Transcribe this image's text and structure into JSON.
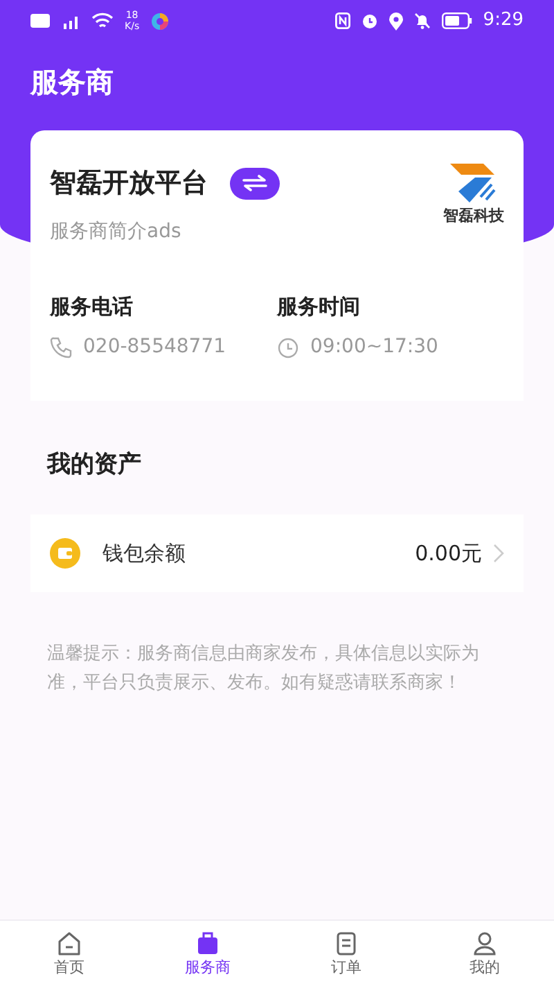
{
  "status_bar": {
    "speed": "18\nK/s",
    "time": "9:29"
  },
  "header": {
    "title": "服务商"
  },
  "provider": {
    "name": "智磊开放平台",
    "intro": "服务商简介ads",
    "logo_caption": "智磊科技"
  },
  "contact": [
    {
      "kind": "phone",
      "label": "服务电话",
      "value": "020-85548771"
    },
    {
      "kind": "time",
      "label": "服务时间",
      "value": "09:00~17:30"
    }
  ],
  "assets": {
    "title": "我的资产",
    "rows": [
      {
        "label": "钱包余额",
        "value": "0.00元"
      }
    ]
  },
  "notice": "温馨提示：服务商信息由商家发布，具体信息以实际为准，平台只负责展示、发布。如有疑惑请联系商家！",
  "tabs": [
    {
      "kind": "home",
      "label": "首页",
      "selected": false
    },
    {
      "kind": "provider",
      "label": "服务商",
      "selected": true
    },
    {
      "kind": "orders",
      "label": "订单",
      "selected": false
    },
    {
      "kind": "me",
      "label": "我的",
      "selected": false
    }
  ]
}
